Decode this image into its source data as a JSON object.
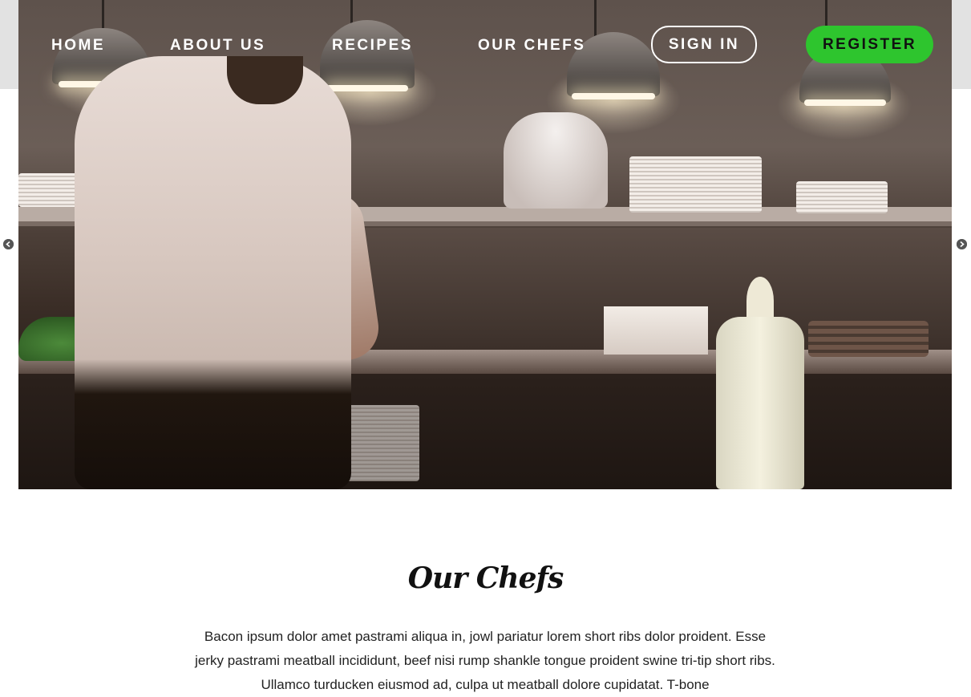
{
  "nav": {
    "items": [
      {
        "label": "HOME"
      },
      {
        "label": "ABOUT US"
      },
      {
        "label": "RECIPES"
      },
      {
        "label": "OUR CHEFS"
      }
    ],
    "signin_label": "SIGN IN",
    "register_label": "REGISTER"
  },
  "carousel": {
    "prev_icon": "arrow-left-circle-icon",
    "next_icon": "arrow-right-circle-icon"
  },
  "section": {
    "title": "Our Chefs",
    "text": "Bacon ipsum dolor amet pastrami aliqua in, jowl pariatur lorem short ribs dolor proident. Esse jerky pastrami meatball incididunt, beef nisi rump shankle tongue proident swine tri-tip short ribs. Ullamco turducken eiusmod ad, culpa ut meatball dolore cupidatat. T-bone"
  },
  "colors": {
    "register_bg": "#2ec52e",
    "nav_band": "#e2e2e2",
    "nav_text": "#ffffff"
  }
}
